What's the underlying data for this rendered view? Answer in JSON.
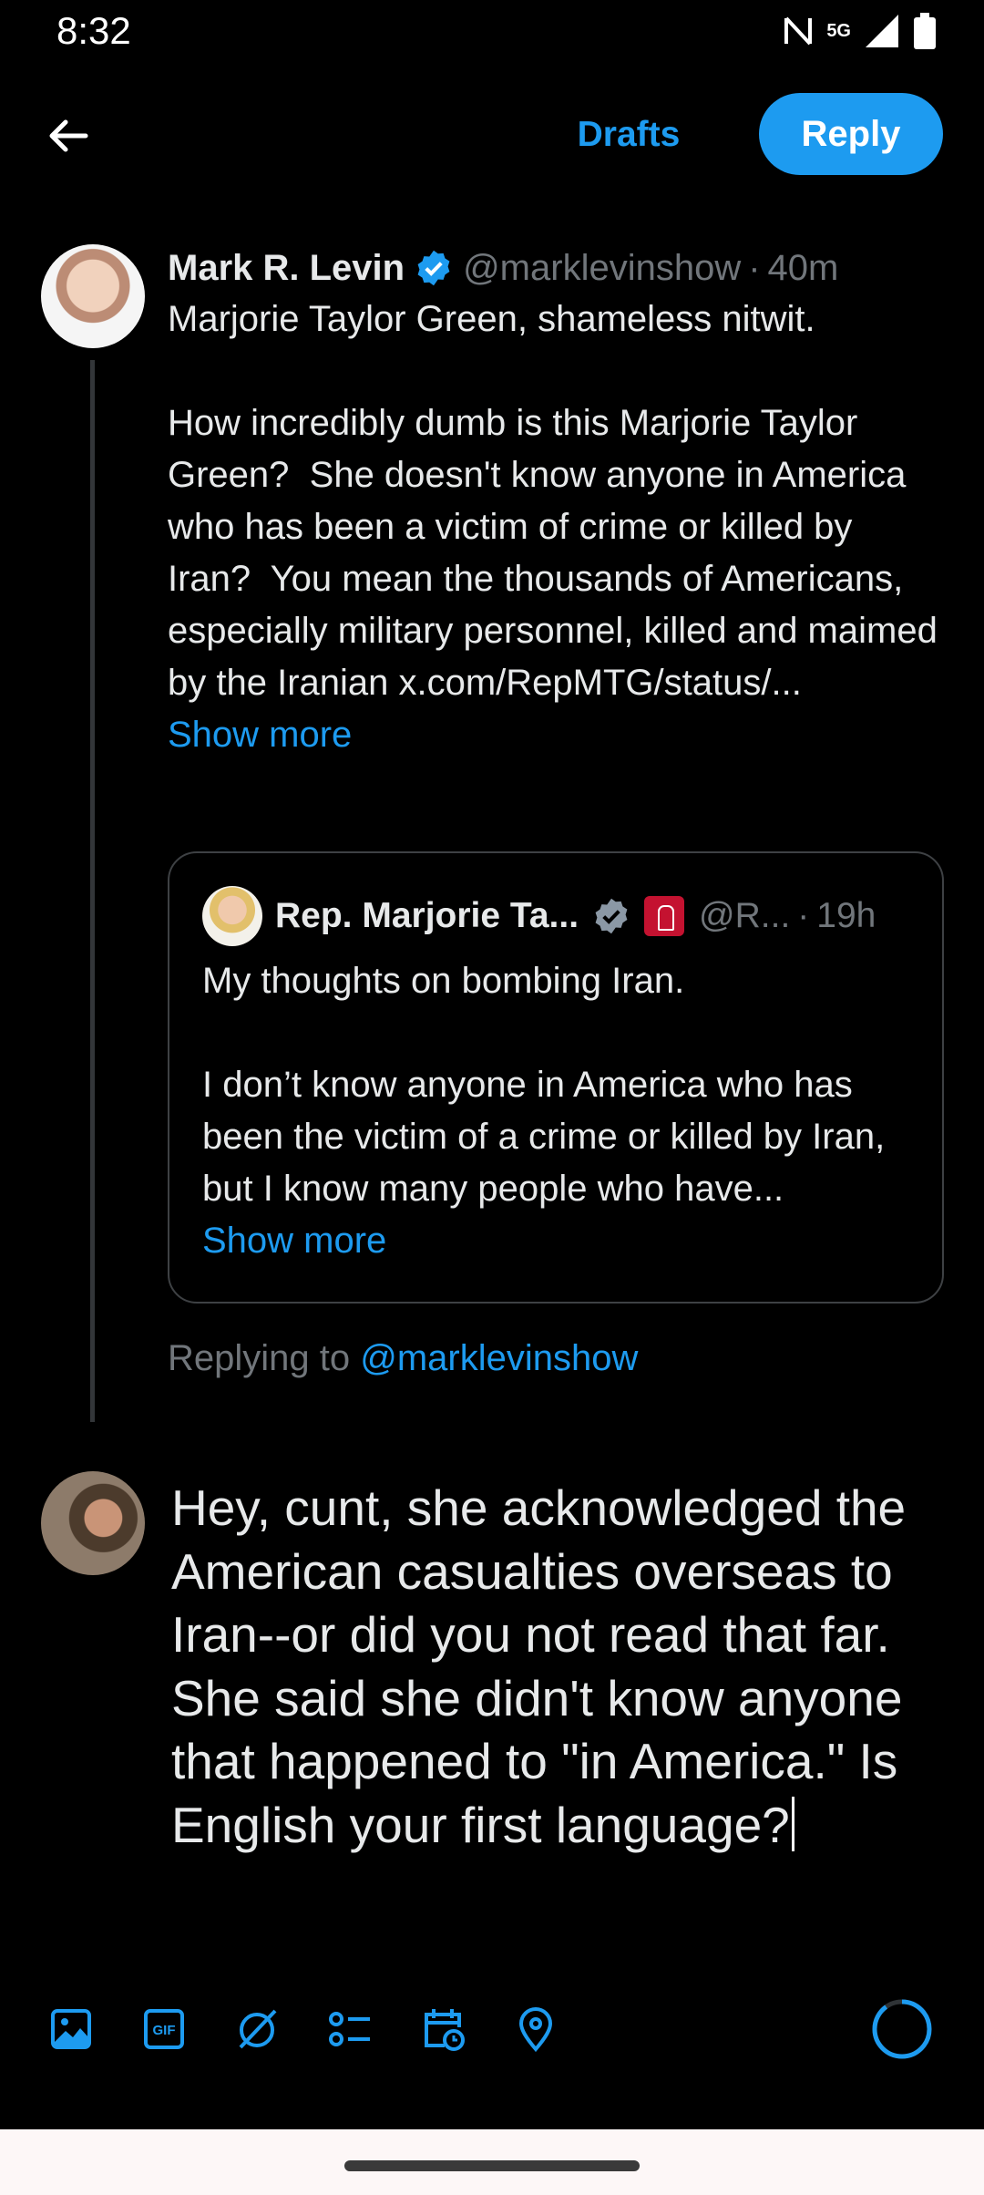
{
  "status_bar": {
    "time": "8:32",
    "network": "5G"
  },
  "header": {
    "back_label": "Back",
    "drafts_label": "Drafts",
    "reply_label": "Reply"
  },
  "tweet": {
    "author_name": "Mark R. Levin",
    "handle": "@marklevinshow",
    "separator": "·",
    "time": "40m",
    "text": "Marjorie Taylor Green, shameless nitwit.\n\nHow incredibly dumb is this Marjorie Taylor Green?  She doesn't know anyone in America who has been a victim of crime or killed by Iran?  You mean the thousands of Americans, especially military personnel, killed and maimed by the Iranian x.com/RepMTG/status/...",
    "show_more": "Show more"
  },
  "quote": {
    "author_name": "Rep. Marjorie Ta...",
    "handle": "@R...",
    "separator": "·",
    "time": "19h",
    "text": "My thoughts on bombing Iran.\n\nI don’t know anyone in America who has been the victim of a crime or killed by Iran, but I know many people who have...",
    "show_more": "Show more"
  },
  "replying_to": {
    "prefix": "Replying to ",
    "mention": "@marklevinshow"
  },
  "compose": {
    "text": "Hey, cunt, she acknowledged the American casualties overseas to Iran--or did you not read that far. She said she didn't know anyone that happened to \"in America.\" Is English your first language?"
  },
  "toolbar": {
    "icons": [
      "image-icon",
      "gif-icon",
      "grok-icon",
      "poll-icon",
      "schedule-icon",
      "location-icon"
    ],
    "char_progress": 0.9
  },
  "colors": {
    "accent": "#1d9bf0",
    "background": "#000000",
    "muted": "#71767b",
    "text": "#e7e9ea"
  }
}
